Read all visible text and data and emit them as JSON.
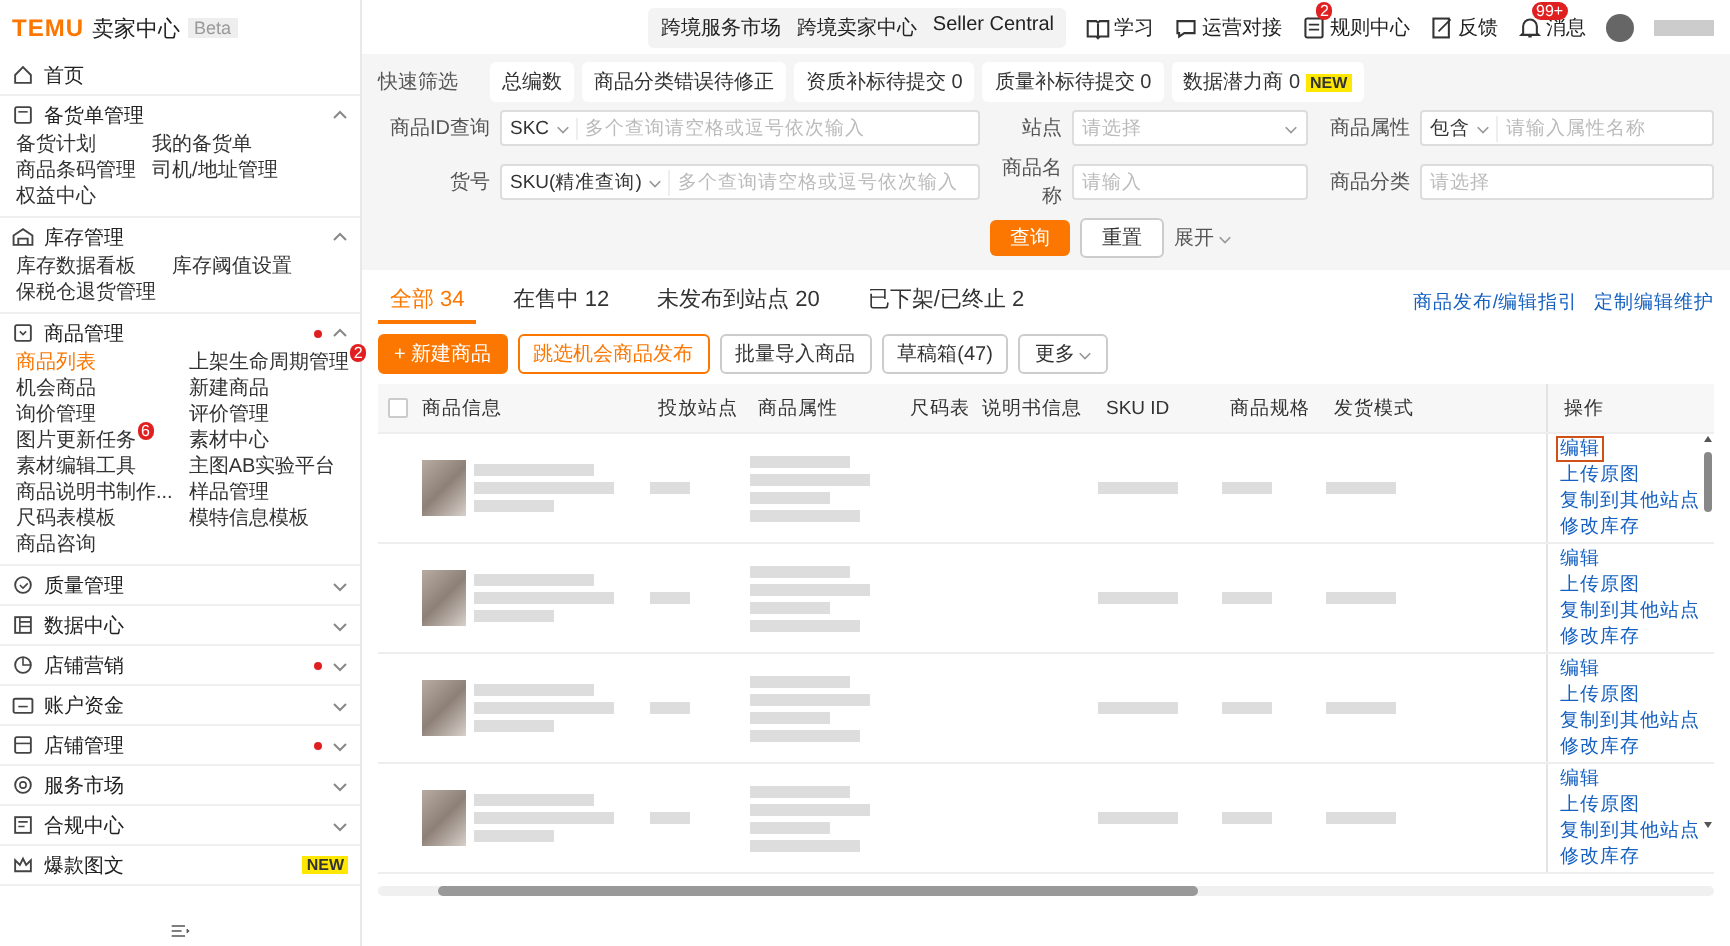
{
  "brand": {
    "logo": "TEMU",
    "title": "卖家中心",
    "tag": "Beta"
  },
  "sidebar": {
    "groups": [
      {
        "label": "首页"
      },
      {
        "label": "备货单管理",
        "expanded": true,
        "dot": false,
        "children": [
          {
            "label": "备货计划",
            "selected": false
          },
          {
            "label": "我的备货单",
            "selected": false
          },
          {
            "label": "商品条码管理",
            "selected": false
          },
          {
            "label": "司机/地址管理",
            "selected": false
          },
          {
            "label": "权益中心",
            "selected": false
          }
        ]
      },
      {
        "label": "库存管理",
        "expanded": true,
        "dot": false,
        "children": [
          {
            "label": "库存数据看板",
            "selected": false
          },
          {
            "label": "库存阈值设置",
            "selected": false
          },
          {
            "label": "保税仓退货管理",
            "selected": false
          }
        ]
      },
      {
        "label": "商品管理",
        "expanded": true,
        "dot": true,
        "children": [
          {
            "label": "商品列表",
            "selected": true
          },
          {
            "label": "上架生命周期管理",
            "selected": false,
            "badge": "2"
          },
          {
            "label": "机会商品",
            "selected": false
          },
          {
            "label": "新建商品",
            "selected": false
          },
          {
            "label": "询价管理",
            "selected": false
          },
          {
            "label": "评价管理",
            "selected": false
          },
          {
            "label": "图片更新任务",
            "selected": false,
            "badge": "6"
          },
          {
            "label": "素材中心",
            "selected": false
          },
          {
            "label": "素材编辑工具",
            "selected": false
          },
          {
            "label": "主图AB实验平台",
            "selected": false
          },
          {
            "label": "商品说明书制作...",
            "selected": false
          },
          {
            "label": "样品管理",
            "selected": false
          },
          {
            "label": "尺码表模板",
            "selected": false
          },
          {
            "label": "模特信息模板",
            "selected": false
          },
          {
            "label": "商品咨询",
            "selected": false
          }
        ]
      },
      {
        "label": "质量管理",
        "expanded": false,
        "dot": false
      },
      {
        "label": "数据中心",
        "expanded": false,
        "dot": false
      },
      {
        "label": "店铺营销",
        "expanded": false,
        "dot": true
      },
      {
        "label": "账户资金",
        "expanded": false,
        "dot": false
      },
      {
        "label": "店铺管理",
        "expanded": false,
        "dot": true
      },
      {
        "label": "服务市场",
        "expanded": false,
        "dot": false
      },
      {
        "label": "合规中心",
        "expanded": false,
        "dot": false
      },
      {
        "label": "爆款图文",
        "tag": "NEW"
      }
    ]
  },
  "topbar": {
    "portals": [
      "跨境服务市场",
      "跨境卖家中心",
      "Seller Central"
    ],
    "tools": [
      {
        "label": "学习"
      },
      {
        "label": "运营对接"
      },
      {
        "label": "规则中心",
        "badge": "2"
      },
      {
        "label": "反馈"
      },
      {
        "label": "消息",
        "badge": "99+"
      }
    ]
  },
  "quick_filter": {
    "label": "快速筛选",
    "chips": [
      {
        "label": "总编数"
      },
      {
        "label": "商品分类错误待修正"
      },
      {
        "label": "资质补标待提交 0"
      },
      {
        "label": "质量补标待提交 0"
      },
      {
        "label": "数据潜力商 0",
        "tag": "NEW"
      }
    ]
  },
  "filters": [
    {
      "label": "商品ID查询",
      "select": "SKC",
      "placeholder": "多个查询请空格或逗号依次输入"
    },
    {
      "label": "站点",
      "placeholder": "请选择"
    },
    {
      "label": "商品属性",
      "select": "包含",
      "placeholder": "请输入属性名称"
    },
    {
      "label": "货号",
      "select": "SKU(精准查询)",
      "placeholder": "多个查询请空格或逗号依次输入"
    },
    {
      "label": "商品名称",
      "placeholder": "请输入"
    },
    {
      "label": "商品分类",
      "placeholder": "请选择"
    }
  ],
  "filter_buttons": {
    "search": "查询",
    "reset": "重置",
    "expand": "展开"
  },
  "tabs": [
    {
      "label": "全部 34",
      "selected": true
    },
    {
      "label": "在售中 12",
      "selected": false
    },
    {
      "label": "未发布到站点 20",
      "selected": false
    },
    {
      "label": "已下架/已终止 2",
      "selected": false
    }
  ],
  "links": [
    "商品发布/编辑指引",
    "定制编辑维护"
  ],
  "actions": [
    {
      "label": "+ 新建商品",
      "kind": "primary"
    },
    {
      "label": "跳选机会商品发布",
      "kind": "outline"
    },
    {
      "label": "批量导入商品",
      "kind": "default"
    },
    {
      "label": "草稿箱(47)",
      "kind": "default"
    },
    {
      "label": "更多",
      "kind": "menu"
    }
  ],
  "table": {
    "all_checked": false,
    "columns": [
      "商品信息",
      "投放站点",
      "商品属性",
      "尺码表",
      "说明书信息",
      "SKU ID",
      "商品规格",
      "发货模式",
      "操作"
    ],
    "rows": [
      {
        "actions": [
          {
            "label": "编辑",
            "focused": true
          },
          {
            "label": "上传原图",
            "focused": false
          },
          {
            "label": "复制到其他站点",
            "focused": false
          },
          {
            "label": "修改库存",
            "focused": false
          }
        ]
      },
      {
        "actions": [
          {
            "label": "编辑",
            "focused": false
          },
          {
            "label": "上传原图",
            "focused": false
          },
          {
            "label": "复制到其他站点",
            "focused": false
          },
          {
            "label": "修改库存",
            "focused": false
          }
        ]
      },
      {
        "actions": [
          {
            "label": "编辑",
            "focused": false
          },
          {
            "label": "上传原图",
            "focused": false
          },
          {
            "label": "复制到其他站点",
            "focused": false
          },
          {
            "label": "修改库存",
            "focused": false
          }
        ]
      },
      {
        "actions": [
          {
            "label": "编辑",
            "focused": false
          },
          {
            "label": "上传原图",
            "focused": false
          },
          {
            "label": "复制到其他站点",
            "focused": false
          },
          {
            "label": "修改库存",
            "focused": false
          }
        ]
      }
    ]
  }
}
